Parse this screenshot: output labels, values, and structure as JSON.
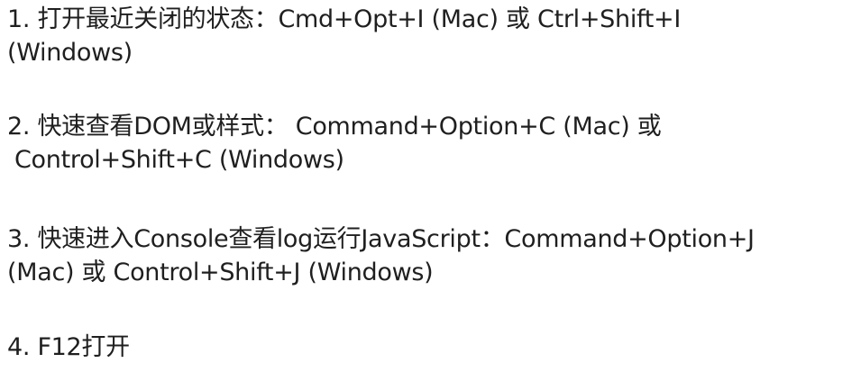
{
  "items": [
    {
      "line1": "1. 打开最近关闭的状态：Cmd+Opt+I (Mac) 或 Ctrl+Shift+I",
      "line2": "(Windows)"
    },
    {
      "line1": "2. 快速查看DOM或样式： Command+Option+C (Mac) 或",
      "line2": "Control+Shift+C (Windows)"
    },
    {
      "line1": "3. 快速进入Console查看log运行JavaScript：Command+Option+J",
      "line2": "(Mac) 或 Control+Shift+J (Windows)"
    },
    {
      "line1": "4. F12打开"
    }
  ]
}
